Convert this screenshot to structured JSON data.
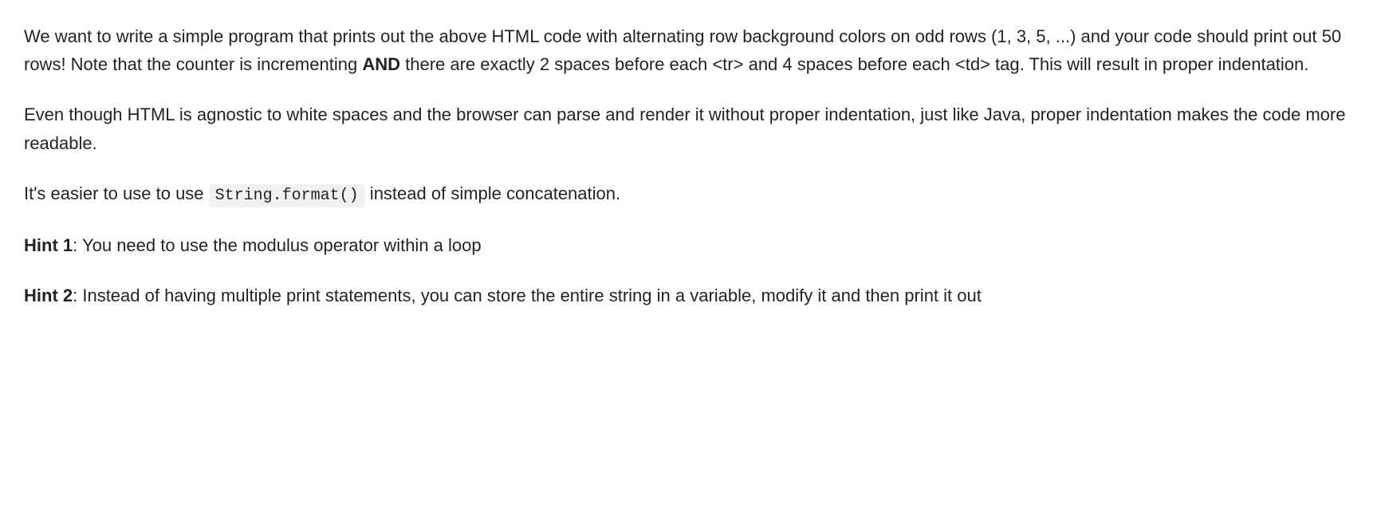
{
  "paragraphs": {
    "p1": {
      "part1": "We want to write a simple program that prints out the above HTML code with alternating row background colors on odd rows (1, 3, 5, ...) and your code should print out 50 rows! Note that the counter is incrementing ",
      "bold1": "AND",
      "part2": " there are exactly 2 spaces before each <tr> and 4 spaces before each <td> tag. This will result in proper indentation."
    },
    "p2": "Even though HTML is agnostic to white spaces and the browser can parse and render it without proper indentation, just like Java, proper indentation makes the code more readable.",
    "p3": {
      "part1": "It's easier to use to use ",
      "code1": "String.format()",
      "part2": " instead of simple concatenation."
    },
    "p4": {
      "bold1": "Hint 1",
      "part1": ": You need to use the modulus operator within a loop"
    },
    "p5": {
      "bold1": "Hint 2",
      "part1": ": Instead of having multiple print statements, you can store the entire string in a variable, modify it and then print it out"
    }
  }
}
